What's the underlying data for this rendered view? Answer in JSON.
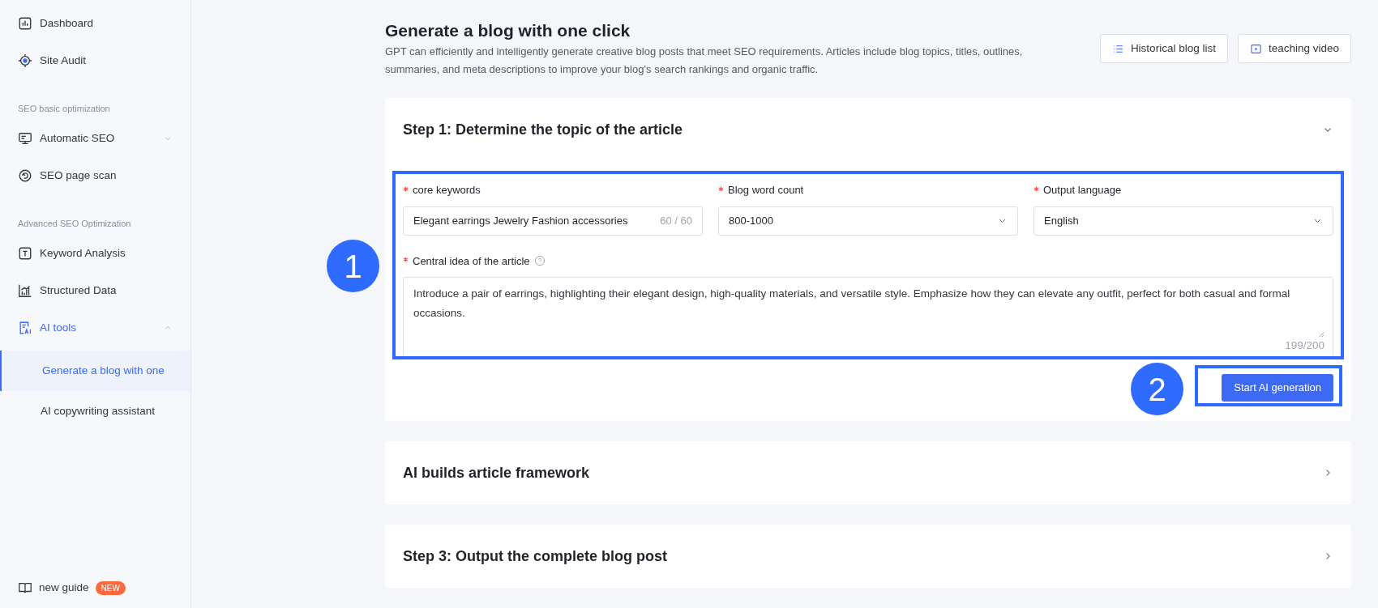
{
  "sidebar": {
    "items": [
      {
        "kind": "item",
        "label": "Dashboard",
        "selected": false
      },
      {
        "kind": "item",
        "label": "Site Audit",
        "selected": false
      },
      {
        "kind": "section",
        "label": "SEO basic optimization"
      },
      {
        "kind": "item",
        "label": "Automatic SEO",
        "selected": false,
        "expanded": false
      },
      {
        "kind": "item",
        "label": "SEO page scan",
        "selected": false
      },
      {
        "kind": "section",
        "label": "Advanced SEO Optimization"
      },
      {
        "kind": "item",
        "label": "Keyword Analysis",
        "selected": false
      },
      {
        "kind": "item",
        "label": "Structured Data",
        "selected": false
      },
      {
        "kind": "item",
        "label": "AI tools",
        "selected": false,
        "active": true,
        "expanded": true,
        "children": [
          {
            "label": "Generate a blog with one",
            "selected": true
          },
          {
            "label": "AI copywriting assistant",
            "selected": false
          }
        ]
      }
    ],
    "footer": {
      "label": "new guide",
      "badge": "NEW"
    }
  },
  "header": {
    "title": "Generate a blog with one click",
    "description": "GPT can efficiently and intelligently generate creative blog posts that meet SEO requirements. Articles include blog topics, titles, outlines, summaries, and meta descriptions to improve your blog’s search rankings and organic traffic.",
    "buttons": [
      {
        "label": "Historical blog list"
      },
      {
        "label": "teaching video"
      }
    ]
  },
  "steps": [
    {
      "title": "Step 1: Determine the topic of the article",
      "expanded": true,
      "fields": [
        {
          "kind": "input",
          "label": "core keywords",
          "required": true,
          "value": "Elegant earrings Jewelry Fashion accessories",
          "counter": "60 / 60"
        },
        {
          "kind": "select",
          "label": "Blog word count",
          "required": true,
          "value": "800-1000"
        },
        {
          "kind": "select",
          "label": "Output language",
          "required": true,
          "value": "English"
        }
      ],
      "idea": {
        "label": "Central idea of the article",
        "required": true,
        "value": "Introduce a pair of earrings, highlighting their elegant design, high-quality materials, and versatile style. Emphasize how they can elevate any outfit, perfect for both casual and formal occasions.",
        "counter": "199/200"
      },
      "button": "Start AI generation",
      "annotations": [
        "1",
        "2"
      ]
    },
    {
      "title": "AI builds article framework",
      "expanded": false
    },
    {
      "title": "Step 3: Output the complete blog post",
      "expanded": false
    }
  ]
}
